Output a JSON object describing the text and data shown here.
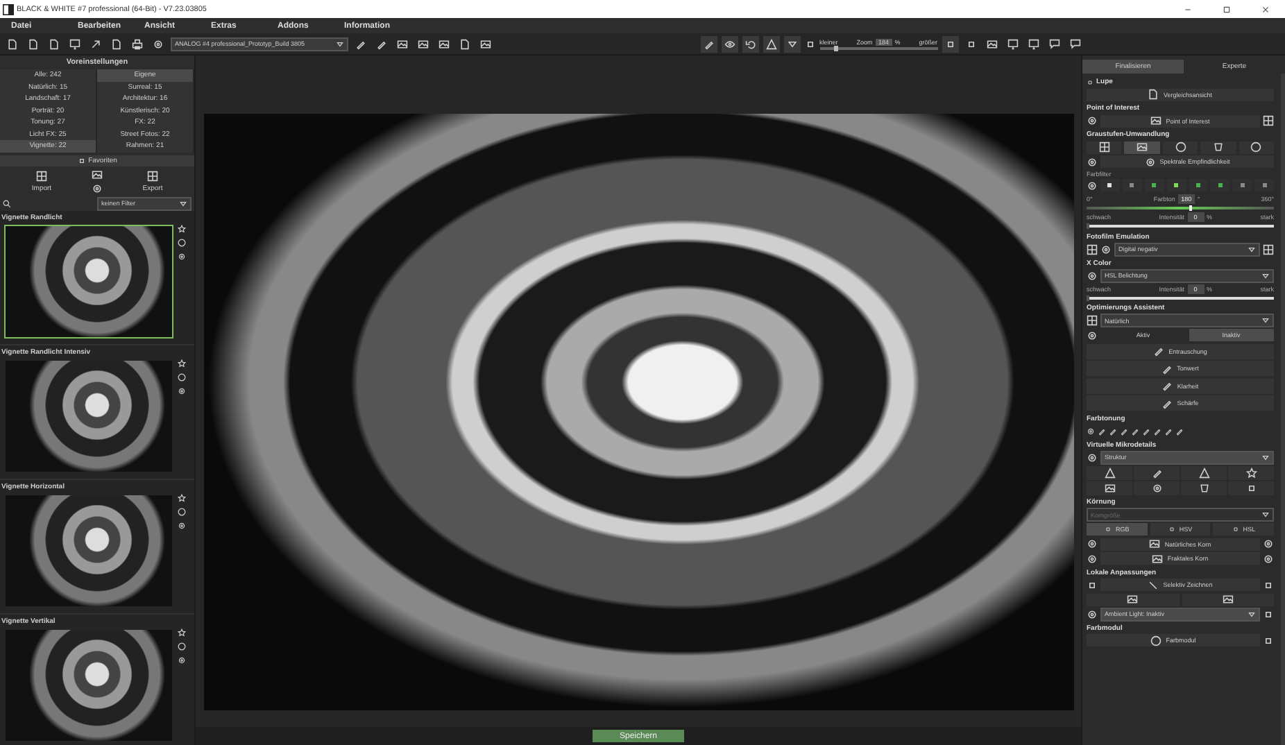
{
  "window": {
    "title": "BLACK & WHITE #7 professional (64-Bit) - V7.23.03805"
  },
  "menu": [
    "Datei",
    "Bearbeiten",
    "Ansicht",
    "Extras",
    "Addons",
    "Information"
  ],
  "toolbar": {
    "preset_select": "ANALOG #4 professional_Prototyp_Build 3805",
    "zoom": {
      "smaller": "kleiner",
      "label": "Zoom",
      "value": "184",
      "unit": "%",
      "larger": "größer",
      "level": 0.12
    }
  },
  "presets": {
    "title": "Voreinstellungen",
    "all": "Alle: 242",
    "own": "Eigene",
    "categories": [
      {
        "label": "Natürlich: 15",
        "selected": false
      },
      {
        "label": "Surreal: 15",
        "selected": false
      },
      {
        "label": "Landschaft: 17",
        "selected": false
      },
      {
        "label": "Architektur: 16",
        "selected": false
      },
      {
        "label": "Porträt: 20",
        "selected": false
      },
      {
        "label": "Künstlerisch: 20",
        "selected": false
      },
      {
        "label": "Tonung: 27",
        "selected": false
      },
      {
        "label": "FX: 22",
        "selected": false
      },
      {
        "label": "Licht FX: 25",
        "selected": false
      },
      {
        "label": "Street Fotos: 22",
        "selected": false
      },
      {
        "label": "Vignette: 22",
        "selected": true
      },
      {
        "label": "Rahmen: 21",
        "selected": false
      }
    ],
    "favorites": "Favoriten",
    "import": "Import",
    "export": "Export",
    "filter": "keinen Filter",
    "items": [
      {
        "name": "Vignette Randlicht",
        "selected": true
      },
      {
        "name": "Vignette Randlicht Intensiv",
        "selected": false
      },
      {
        "name": "Vignette Horizontal",
        "selected": false
      },
      {
        "name": "Vignette Vertikal",
        "selected": false
      }
    ]
  },
  "canvas": {
    "save": "Speichern"
  },
  "panel": {
    "tabs": [
      {
        "label": "Finalisieren",
        "selected": true
      },
      {
        "label": "Experte",
        "selected": false
      }
    ],
    "lupe": {
      "title": "Lupe",
      "button": "Vergleichsansicht"
    },
    "poi": {
      "title": "Point of Interest",
      "button": "Point of Interest"
    },
    "grayscale": {
      "title": "Graustufen-Umwandlung",
      "modes": [
        {
          "selected": false
        },
        {
          "selected": true
        },
        {
          "selected": false
        },
        {
          "selected": false
        },
        {
          "selected": false
        }
      ],
      "spectral": "Spektrale Empfindlichkeit",
      "filter_label": "Farbfilter",
      "filters": [
        {
          "color": "#e0e0e0"
        },
        {
          "color": "#8a8a8a"
        },
        {
          "color": "#4caf50"
        },
        {
          "color": "#7ed957"
        },
        {
          "color": "#4caf50"
        },
        {
          "color": "#4caf50"
        },
        {
          "color": "#8a8a8a"
        },
        {
          "color": "#8a8a8a"
        }
      ],
      "hue": {
        "min": "0°",
        "label": "Farbton",
        "value": "180",
        "unit": "°",
        "max": "360°",
        "level": 0.55
      },
      "intensity": {
        "low": "schwach",
        "label": "Intensität",
        "value": "0",
        "unit": "%",
        "high": "stark",
        "level": 0
      }
    },
    "film": {
      "title": "Fotofilm Emulation",
      "value": "Digital negativ"
    },
    "xcolor": {
      "title": "X Color",
      "value": "HSL Belichtung",
      "intensity": {
        "low": "schwach",
        "label": "Intensität",
        "value": "0",
        "unit": "%",
        "high": "stark",
        "level": 0
      }
    },
    "assistant": {
      "title": "Optimierungs Assistent",
      "value": "Natürlich",
      "states": [
        {
          "label": "Aktiv",
          "selected": false
        },
        {
          "label": "Inaktiv",
          "selected": true
        }
      ],
      "tools": [
        "Entrauschung",
        "Tonwert",
        "Klarheit",
        "Schärfe"
      ]
    },
    "toning": {
      "title": "Farbtonung"
    },
    "micro": {
      "title": "Virtuelle Mikrodetails",
      "value": "Struktur"
    },
    "grain": {
      "title": "Körnung",
      "value": "Korngröße",
      "disabled": true,
      "modes": [
        {
          "label": "RGB",
          "selected": true
        },
        {
          "label": "HSV",
          "selected": false
        },
        {
          "label": "HSL",
          "selected": false
        }
      ],
      "buttons": [
        "Natürliches Korn",
        "Fraktales Korn"
      ]
    },
    "local": {
      "title": "Lokale Anpassungen",
      "draw": "Selektiv Zeichnen",
      "ambient": "Ambient Light: Inaktiv"
    },
    "colormodule": {
      "title": "Farbmodul",
      "button": "Farbmodul"
    }
  }
}
